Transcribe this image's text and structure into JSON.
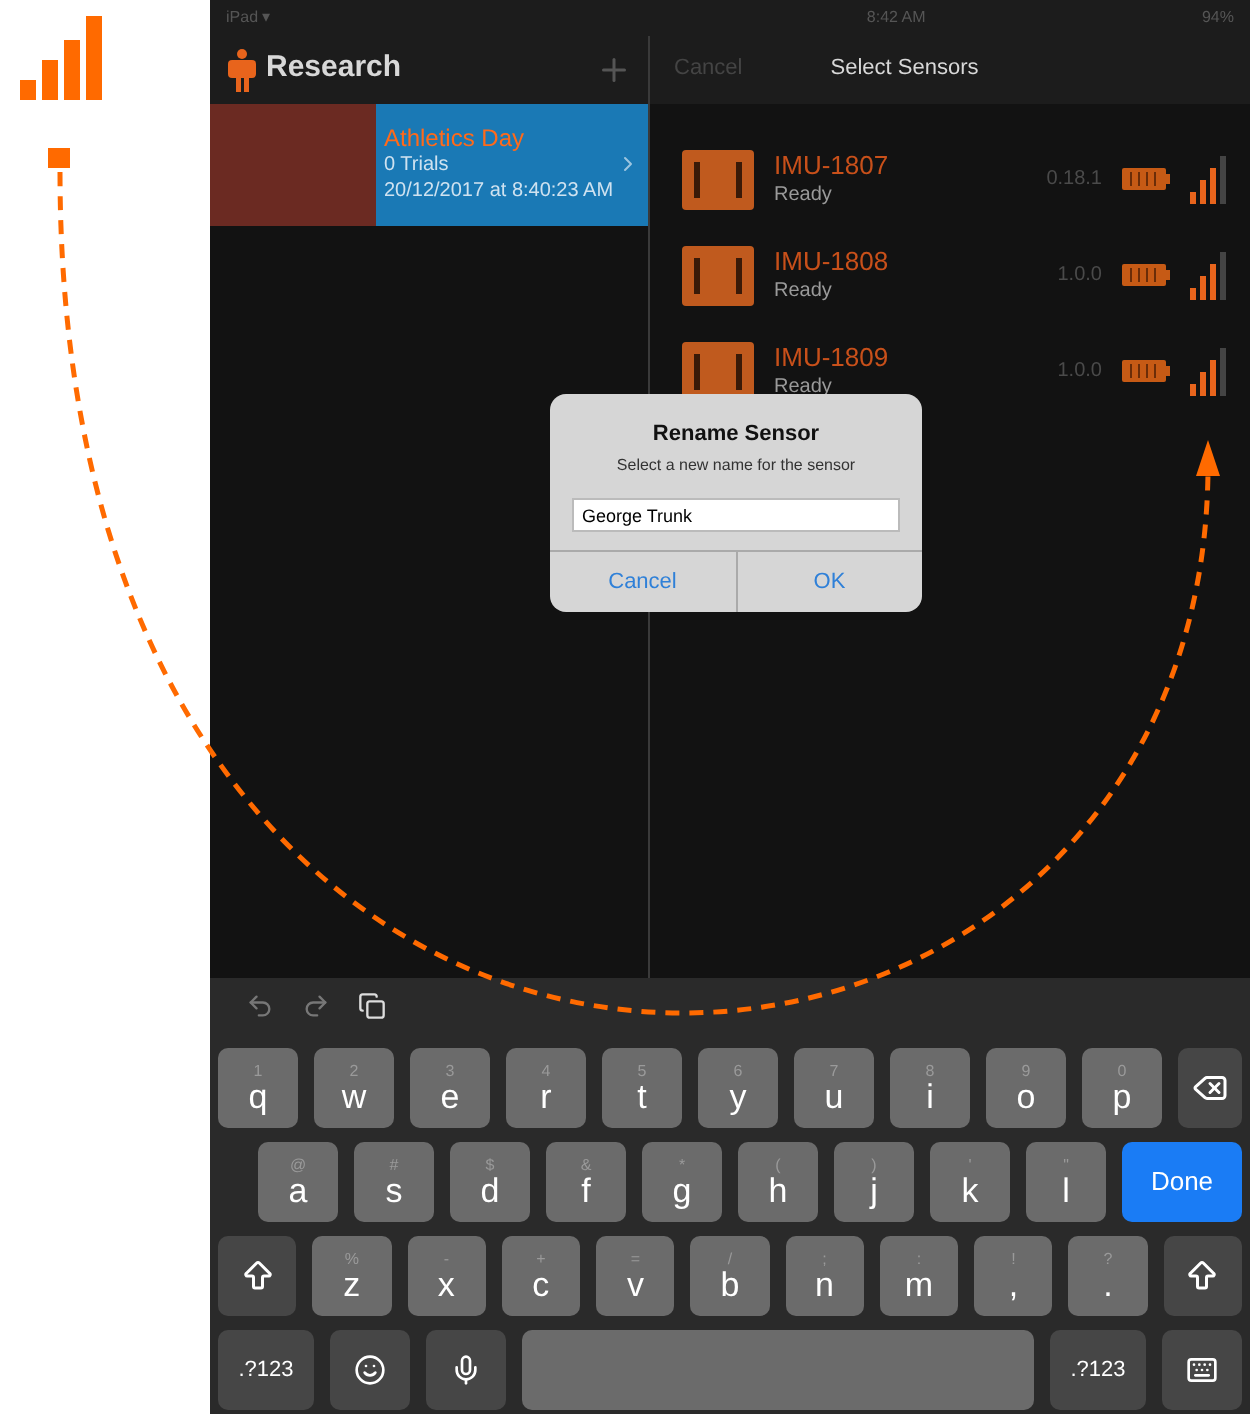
{
  "status_bar": {
    "device": "iPad ▾",
    "time": "8:42 AM",
    "battery": "94%"
  },
  "left_nav": {
    "title": "Research"
  },
  "sessions": [
    {
      "title": "Athletics Day",
      "trials": "0 Trials",
      "date": "20/12/2017 at 8:40:23 AM",
      "selected": true
    }
  ],
  "right_nav": {
    "cancel": "Cancel",
    "title": "Select Sensors"
  },
  "sensors": [
    {
      "name": "IMU-1807",
      "status": "Ready",
      "version": "0.18.1"
    },
    {
      "name": "IMU-1808",
      "status": "Ready",
      "version": "1.0.0"
    },
    {
      "name": "IMU-1809",
      "status": "Ready",
      "version": "1.0.0"
    }
  ],
  "dialog": {
    "title": "Rename Sensor",
    "message": "Select a new name for the sensor",
    "value": "George Trunk",
    "buttons": [
      "Cancel",
      "OK"
    ]
  },
  "keyboard": {
    "key_rows": [
      {
        "keys": [
          {
            "kind": "letter",
            "label": "q",
            "hint": "1"
          },
          {
            "kind": "letter",
            "label": "w",
            "hint": "2"
          },
          {
            "kind": "letter",
            "label": "e",
            "hint": "3"
          },
          {
            "kind": "letter",
            "label": "r",
            "hint": "4"
          },
          {
            "kind": "letter",
            "label": "t",
            "hint": "5"
          },
          {
            "kind": "letter",
            "label": "y",
            "hint": "6"
          },
          {
            "kind": "letter",
            "label": "u",
            "hint": "7"
          },
          {
            "kind": "letter",
            "label": "i",
            "hint": "8"
          },
          {
            "kind": "letter",
            "label": "o",
            "hint": "9"
          },
          {
            "kind": "letter",
            "label": "p",
            "hint": "0"
          },
          {
            "kind": "backspace"
          }
        ]
      },
      {
        "keys": [
          {
            "kind": "letter",
            "label": "a",
            "hint": "@"
          },
          {
            "kind": "letter",
            "label": "s",
            "hint": "#"
          },
          {
            "kind": "letter",
            "label": "d",
            "hint": "$"
          },
          {
            "kind": "letter",
            "label": "f",
            "hint": "&"
          },
          {
            "kind": "letter",
            "label": "g",
            "hint": "*"
          },
          {
            "kind": "letter",
            "label": "h",
            "hint": "("
          },
          {
            "kind": "letter",
            "label": "j",
            "hint": ")"
          },
          {
            "kind": "letter",
            "label": "k",
            "hint": "'"
          },
          {
            "kind": "letter",
            "label": "l",
            "hint": "\""
          },
          {
            "kind": "done",
            "label": "Done"
          }
        ]
      },
      {
        "keys": [
          {
            "kind": "shift"
          },
          {
            "kind": "letter",
            "label": "z",
            "hint": "%"
          },
          {
            "kind": "letter",
            "label": "x",
            "hint": "-"
          },
          {
            "kind": "letter",
            "label": "c",
            "hint": "+"
          },
          {
            "kind": "letter",
            "label": "v",
            "hint": "="
          },
          {
            "kind": "letter",
            "label": "b",
            "hint": "/"
          },
          {
            "kind": "letter",
            "label": "n",
            "hint": ";"
          },
          {
            "kind": "letter",
            "label": "m",
            "hint": ":"
          },
          {
            "kind": "letter",
            "label": ",",
            "hint": "!"
          },
          {
            "kind": "letter",
            "label": ".",
            "hint": "?"
          },
          {
            "kind": "shift"
          }
        ]
      },
      {
        "keys": [
          {
            "kind": "mode",
            "label": ".?123"
          },
          {
            "kind": "emoji"
          },
          {
            "kind": "mic"
          },
          {
            "kind": "space"
          },
          {
            "kind": "mode",
            "label": ".?123"
          },
          {
            "kind": "hide"
          }
        ]
      }
    ]
  }
}
